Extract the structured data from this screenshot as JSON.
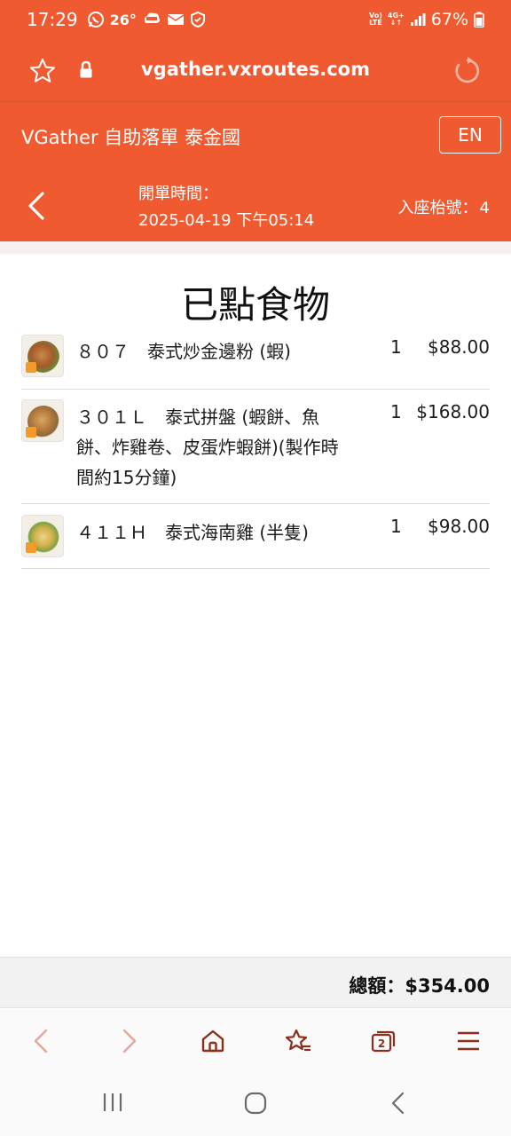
{
  "status_bar": {
    "time": "17:29",
    "temperature": "26°",
    "battery": "67%",
    "network_tag_1": "Vo)) LTE",
    "network_tag_2": "4G+",
    "icons": [
      "whatsapp-icon",
      "weather-icon",
      "hktv-icon",
      "mail-icon",
      "shield-icon",
      "volte-icon",
      "4g-icon",
      "signal-icon",
      "battery-icon"
    ]
  },
  "browser": {
    "url": "vgather.vxroutes.com"
  },
  "header": {
    "title": "VGather 自助落單 泰金國",
    "lang_button": "EN"
  },
  "order_info": {
    "open_time_label": "開單時間：",
    "open_time_value": "2025-04-19 下午05:14",
    "table_label": "入座枱號：",
    "table_number": "4"
  },
  "main": {
    "title": "已點食物",
    "items": [
      {
        "name": "８０７　泰式炒金邊粉 (蝦)",
        "qty": "1",
        "price": "$88.00"
      },
      {
        "name": "３０１Ｌ　泰式拼盤 (蝦餅、魚餅、炸雞卷、皮蛋炸蝦餅)(製作時間約15分鐘)",
        "qty": "1",
        "price": "$168.00"
      },
      {
        "name": "４１１Ｈ　泰式海南雞 (半隻)",
        "qty": "1",
        "price": "$98.00"
      }
    ]
  },
  "total": {
    "label": "總額：",
    "value": "$354.00"
  },
  "colors": {
    "brand": "#ef5a30",
    "nav_icon": "#8b2e1c"
  }
}
